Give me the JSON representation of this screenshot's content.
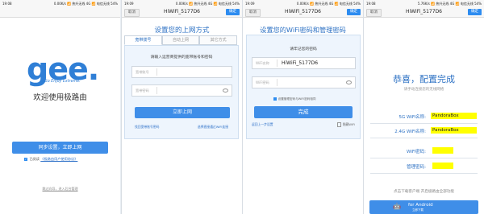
{
  "status": {
    "s1": {
      "time": "19:08",
      "right": "0.00K/s  📶 热升无线 4G  📶 电信无线  54%"
    },
    "s2": {
      "time": "19:09",
      "right": "0.00K/s  📶 热升无线 4G  📶 电信无线  54%"
    },
    "s3": {
      "time": "19:09",
      "right": "0.00K/s  📶 热升无线 4G  📶 电信无线  54%"
    },
    "s4": {
      "time": "19:08",
      "right": "5.76K/s  📶 热升无线 4G  📶 电信无线  54%"
    }
  },
  "nav": {
    "cancel": "取消",
    "done": "确定",
    "title": "HiWiFi_5177D6"
  },
  "screen1": {
    "logo_text": "gee.",
    "logo_tagline": "Go Enjoy Extreme.",
    "welcome": "欢迎使用极路由",
    "primary_button": "同步设置，立即上网",
    "agree_prefix": "已阅读",
    "agree_link": "《极路由用户使用协议》",
    "footer_link": "跳过向导，进入后台管理"
  },
  "screen2": {
    "heading": "设置您的上网方式",
    "tabs": [
      "宽带拨号",
      "自动上网",
      "其它方式"
    ],
    "hint": "请输入运营商提供的宽带账号和密码",
    "account_label": "宽带账号",
    "password_label": "宽带密码",
    "submit": "立即上网",
    "link_left": "找回宽带账号密码",
    "link_right": "选择直接通过WiFi连接"
  },
  "screen3": {
    "heading": "设置您的WiFi密码和管理密码",
    "hint": "请牢记您的密码",
    "wifi_name_label": "WiFi名称",
    "wifi_name_value": "HiWiFi_5177D6",
    "wifi_password_label": "WiFi密码",
    "same_password_note": "设置管理密码与WiFi密码相同",
    "submit": "完成",
    "link_left": "返回上一步设置",
    "link_right": "隐藏WiFi"
  },
  "screen4": {
    "heading": "恭喜，配置完成",
    "sub": "请手动连接您的无线网络",
    "rows": [
      {
        "key": "5G WiFi名称:",
        "value": "PandoraBox"
      },
      {
        "key": "2.4G WiFi名称:",
        "value": "PandoraBox"
      },
      {
        "key": "WiFi密码:",
        "value": ""
      },
      {
        "key": "管理密码:",
        "value": ""
      }
    ],
    "download_hint": "点击下载客户端 开启极路由全部功能",
    "download_title": "for Android",
    "download_sub": "立即下载"
  },
  "colors": {
    "accent": "#3f8ee8",
    "heading": "#2e72c4",
    "highlight": "#ffff00"
  }
}
